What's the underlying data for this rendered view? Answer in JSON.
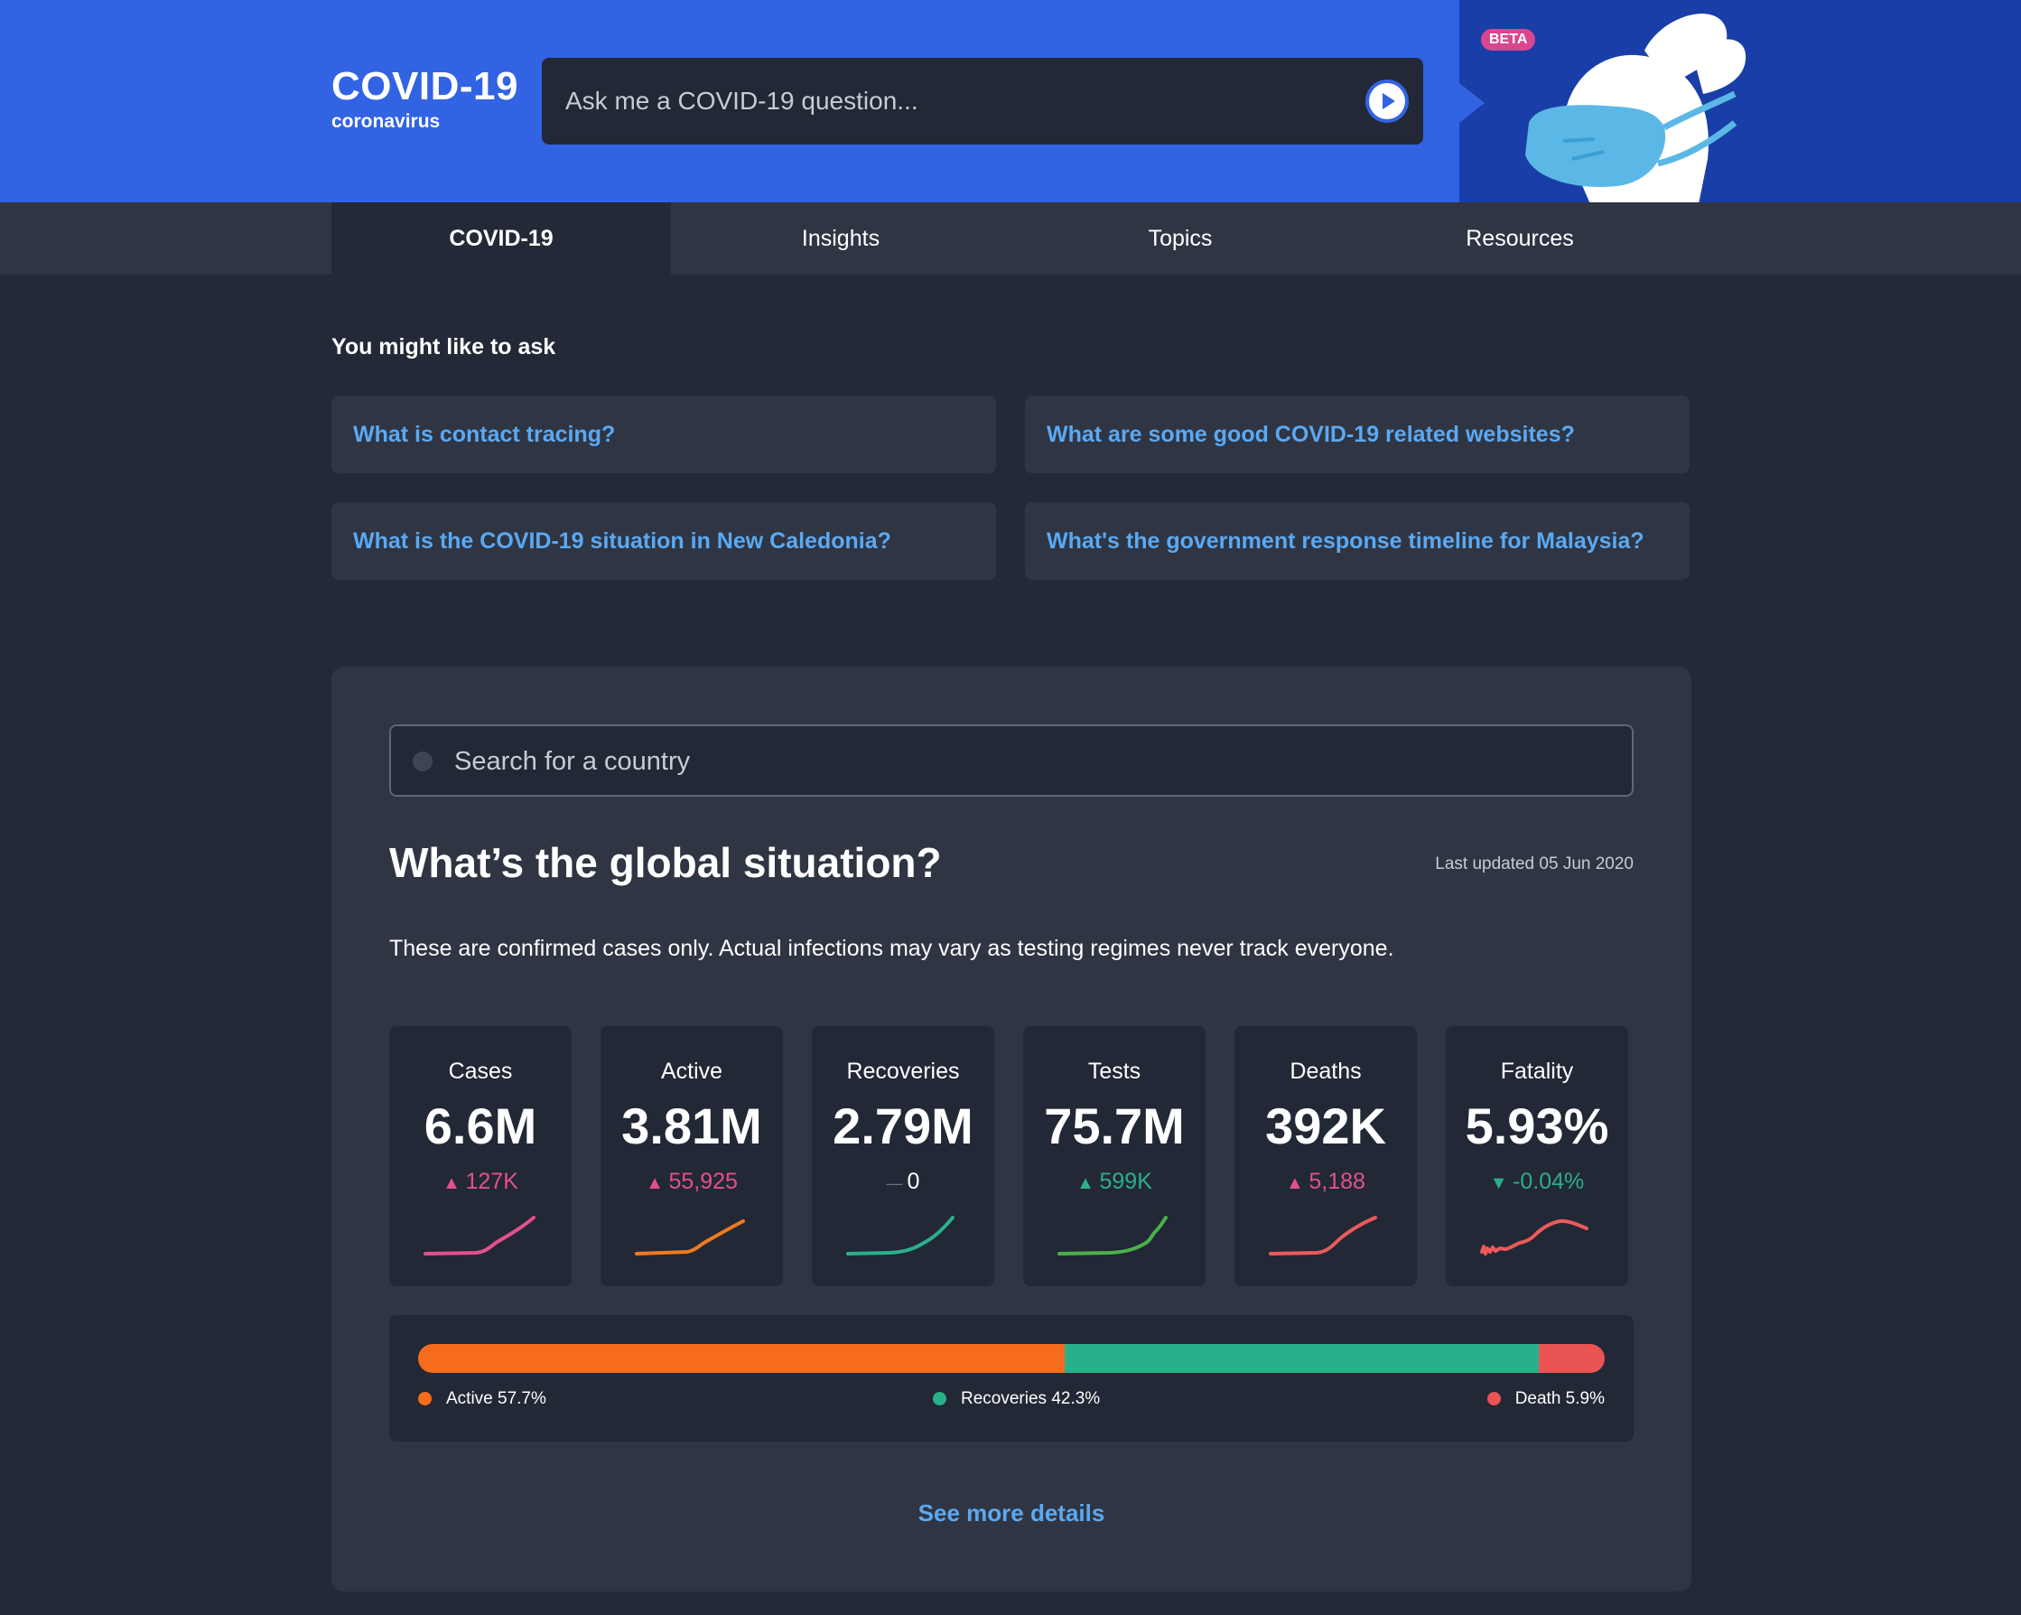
{
  "header": {
    "brand_title": "COVID-19",
    "brand_subtitle": "coronavirus",
    "ask_placeholder": "Ask me a COVID-19 question...",
    "send_icon": "play-icon",
    "beta_label": "BETA",
    "mascot_icon": "masked-rabbit-mascot",
    "colors": {
      "header_bg": "#3163e3",
      "mascot_bg": "#1a3ea8"
    }
  },
  "nav": {
    "tabs": [
      {
        "label": "COVID-19",
        "active": true
      },
      {
        "label": "Insights",
        "active": false
      },
      {
        "label": "Topics",
        "active": false
      },
      {
        "label": "Resources",
        "active": false
      }
    ]
  },
  "suggestions": {
    "heading": "You might like to ask",
    "questions": [
      "What is contact tracing?",
      "What are some good COVID-19 related websites?",
      "What is the COVID-19 situation in New Caledonia?",
      "What's the government response timeline for Malaysia?"
    ]
  },
  "global": {
    "search_placeholder": "Search for a country",
    "title": "What’s the global situation?",
    "last_updated": "Last updated 05 Jun 2020",
    "disclaimer": "These are confirmed cases only. Actual infections may vary as testing regimes never track everyone.",
    "stats": [
      {
        "label": "Cases",
        "value": "6.6M",
        "change": "127K",
        "direction": "up",
        "change_color": "#e4508f",
        "spark_color": "#e4508f"
      },
      {
        "label": "Active",
        "value": "3.81M",
        "change": "55,925",
        "direction": "up",
        "change_color": "#e4508f",
        "spark_color": "#f07a1f"
      },
      {
        "label": "Recoveries",
        "value": "2.79M",
        "change": "0",
        "direction": "flat",
        "change_color": "#ffffff",
        "spark_color": "#2bb08a"
      },
      {
        "label": "Tests",
        "value": "75.7M",
        "change": "599K",
        "direction": "up",
        "change_color": "#2bb08a",
        "spark_color": "#4db04a"
      },
      {
        "label": "Deaths",
        "value": "392K",
        "change": "5,188",
        "direction": "up",
        "change_color": "#e4508f",
        "spark_color": "#ec5a5a"
      },
      {
        "label": "Fatality",
        "value": "5.93%",
        "change": "-0.04%",
        "direction": "down",
        "change_color": "#2bb08a",
        "spark_color": "#ec5a5a"
      }
    ],
    "distribution": [
      {
        "label": "Active 57.7%",
        "value": 57.7,
        "color": "#f76b1c"
      },
      {
        "label": "Recoveries 42.3%",
        "value": 42.3,
        "color": "#27b08a"
      },
      {
        "label": "Death 5.9%",
        "value": 5.9,
        "color": "#ea5455"
      }
    ],
    "see_more": "See more details"
  }
}
